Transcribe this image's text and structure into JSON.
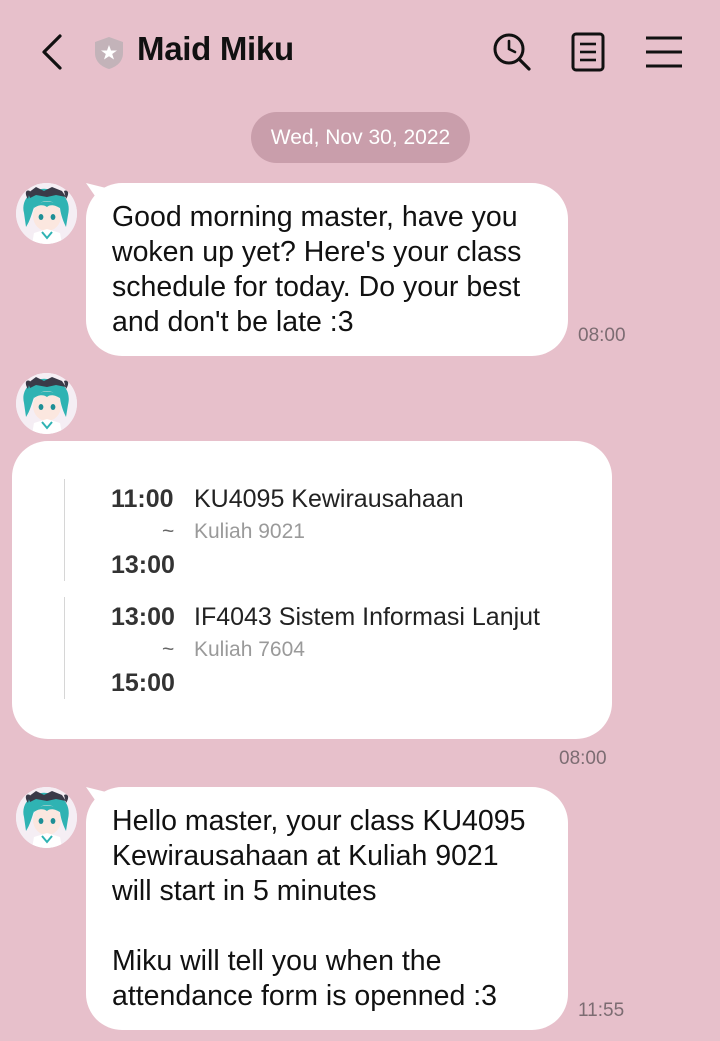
{
  "header": {
    "title": "Maid Miku",
    "icons": [
      "back-icon",
      "shield-star-icon",
      "search-history-icon",
      "notes-icon",
      "menu-icon"
    ]
  },
  "date_separator": "Wed, Nov 30, 2022",
  "messages": [
    {
      "text": "Good morning master, have you\nwoken up yet? Here's your class\nschedule for today. Do your best\nand don't be late :3",
      "time": "08:00"
    },
    {
      "schedule": [
        {
          "start": "11:00",
          "end": "13:00",
          "title": "KU4095 Kewirausahaan",
          "separator": "~",
          "room": "Kuliah 9021"
        },
        {
          "start": "13:00",
          "end": "15:00",
          "title": "IF4043 Sistem Informasi Lanjut",
          "separator": "~",
          "room": "Kuliah 7604"
        }
      ],
      "time": "08:00"
    },
    {
      "text": "Hello master, your class KU4095\nKewirausahaan at Kuliah 9021\nwill start in 5 minutes\n\nMiku will tell you when the\nattendance form is openned :3",
      "time": "11:55"
    }
  ],
  "colors": {
    "background": "#e7c0cb",
    "date_pill": "#c99eab",
    "bubble": "#ffffff",
    "avatar_hair": "#2fb3b3"
  }
}
